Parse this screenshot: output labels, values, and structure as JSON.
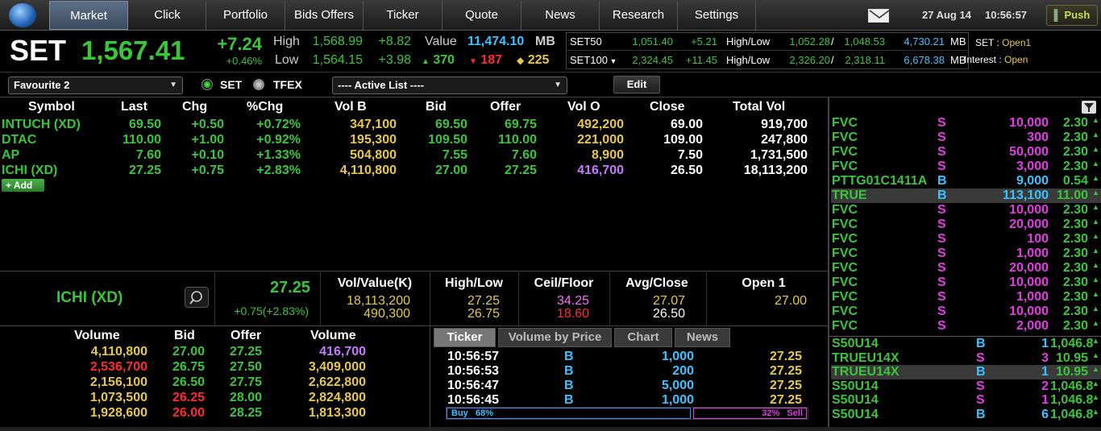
{
  "nav": {
    "tabs": [
      "Market",
      "Click",
      "Portfolio",
      "Bids Offers",
      "Ticker",
      "Quote",
      "News",
      "Research",
      "Settings"
    ],
    "active": "Market",
    "date": "27 Aug 14",
    "time": "10:56:57",
    "push": "Push"
  },
  "index": {
    "name": "SET",
    "value": "1,567.41",
    "chg": "+7.24",
    "pct": "+0.46%",
    "high_label": "High",
    "high": "1,568.99",
    "high_chg": "+8.82",
    "low_label": "Low",
    "low": "1,564.15",
    "low_chg": "+3.98",
    "value_label": "Value",
    "value_amt": "11,474.10",
    "value_unit": "MB",
    "adv": "370",
    "dec": "187",
    "unch": "225"
  },
  "subindex": [
    {
      "name": "SET50",
      "value": "1,051.40",
      "chg": "+5.21",
      "hl_label": "High/Low",
      "high": "1,052.28",
      "low": "1,048.53",
      "amount": "4,730.21",
      "unit": "MB",
      "status_label": "SET",
      "status": "Open1"
    },
    {
      "name": "SET100",
      "value": "2,324.45",
      "chg": "+11.45",
      "hl_label": "High/Low",
      "high": "2,326.20",
      "low": "2,318.11",
      "amount": "6,678.38",
      "unit": "MB",
      "status_label": "Interest",
      "status": "Open"
    }
  ],
  "controls": {
    "favourite": "Favourite 2",
    "market_set": "SET",
    "market_tfex": "TFEX",
    "active_list": "---- Active List ----",
    "edit": "Edit",
    "add": "Add"
  },
  "watch": {
    "headers": [
      "Symbol",
      "Last",
      "Chg",
      "%Chg",
      "Vol B",
      "Bid",
      "Offer",
      "Vol O",
      "Close",
      "Total Vol"
    ],
    "rows": [
      [
        "INTUCH (XD)",
        "69.50",
        "+0.50",
        "+0.72%",
        "347,100",
        "69.50",
        "69.75",
        "492,200",
        "69.00",
        "919,700"
      ],
      [
        "DTAC",
        "110.00",
        "+1.00",
        "+0.92%",
        "195,300",
        "109.50",
        "110.00",
        "221,000",
        "109.00",
        "247,800"
      ],
      [
        "AP",
        "7.60",
        "+0.10",
        "+1.33%",
        "504,800",
        "7.55",
        "7.60",
        "8,900",
        "7.50",
        "1,731,500"
      ],
      [
        "ICHI (XD)",
        "27.25",
        "+0.75",
        "+2.83%",
        "4,110,800",
        "27.00",
        "27.25",
        "416,700",
        "26.50",
        "18,113,200"
      ]
    ]
  },
  "quote": {
    "symbol": "ICHI (XD)",
    "last": "27.25",
    "chg": "+0.75(+2.83%)",
    "cols": [
      {
        "label": "Vol/Value(K)",
        "v1": "18,113,200",
        "v2": "490,300"
      },
      {
        "label": "High/Low",
        "v1": "27.25",
        "v2": "26.75"
      },
      {
        "label": "Ceil/Floor",
        "v1": "34.25",
        "v2": "18.60"
      },
      {
        "label": "Avg/Close",
        "v1": "27.07",
        "v2": "26.50"
      },
      {
        "label": "Open 1",
        "v1": "27.00",
        "v2": ""
      }
    ]
  },
  "depth": {
    "headers": [
      "Volume",
      "Bid",
      "Offer",
      "Volume"
    ],
    "rows": [
      [
        "4,110,800",
        "27.00",
        "27.25",
        "416,700"
      ],
      [
        "2,536,700",
        "26.75",
        "27.50",
        "3,409,000"
      ],
      [
        "2,156,100",
        "26.50",
        "27.75",
        "2,622,800"
      ],
      [
        "1,073,500",
        "26.25",
        "28.00",
        "2,824,800"
      ],
      [
        "1,928,600",
        "26.00",
        "28.25",
        "1,813,300"
      ]
    ]
  },
  "ticker_tabs": [
    "Ticker",
    "Volume by Price",
    "Chart",
    "News"
  ],
  "ticker": {
    "rows": [
      [
        "10:56:57",
        "B",
        "1,000",
        "27.25"
      ],
      [
        "10:56:53",
        "B",
        "200",
        "27.25"
      ],
      [
        "10:56:47",
        "B",
        "5,000",
        "27.25"
      ],
      [
        "10:56:45",
        "B",
        "1,000",
        "27.25"
      ]
    ],
    "buy_label": "Buy",
    "buy_pct": "68%",
    "sell_label": "Sell",
    "sell_pct": "32%",
    "buy_ratio": 0.68
  },
  "stream": {
    "rows": [
      [
        "FVC",
        "S",
        "10,000",
        "2.30"
      ],
      [
        "FVC",
        "S",
        "300",
        "2.30"
      ],
      [
        "FVC",
        "S",
        "50,000",
        "2.30"
      ],
      [
        "FVC",
        "S",
        "3,000",
        "2.30"
      ],
      [
        "PTTG01C1411A",
        "B",
        "9,000",
        "0.54"
      ],
      [
        "TRUE",
        "B",
        "113,100",
        "11.00"
      ],
      [
        "FVC",
        "S",
        "10,000",
        "2.30"
      ],
      [
        "FVC",
        "S",
        "20,000",
        "2.30"
      ],
      [
        "FVC",
        "S",
        "100",
        "2.30"
      ],
      [
        "FVC",
        "S",
        "1,000",
        "2.30"
      ],
      [
        "FVC",
        "S",
        "20,000",
        "2.30"
      ],
      [
        "FVC",
        "S",
        "10,000",
        "2.30"
      ],
      [
        "FVC",
        "S",
        "1,000",
        "2.30"
      ],
      [
        "FVC",
        "S",
        "10,000",
        "2.30"
      ],
      [
        "FVC",
        "S",
        "2,000",
        "2.30"
      ]
    ],
    "rows2": [
      [
        "S50U14",
        "B",
        "1",
        "1,046.8"
      ],
      [
        "TRUEU14X",
        "S",
        "3",
        "10.95"
      ],
      [
        "TRUEU14X",
        "B",
        "1",
        "10.95"
      ],
      [
        "S50U14",
        "S",
        "2",
        "1,046.8"
      ],
      [
        "S50U14",
        "S",
        "1",
        "1,046.8"
      ],
      [
        "S50U14",
        "B",
        "6",
        "1,046.8"
      ]
    ]
  }
}
